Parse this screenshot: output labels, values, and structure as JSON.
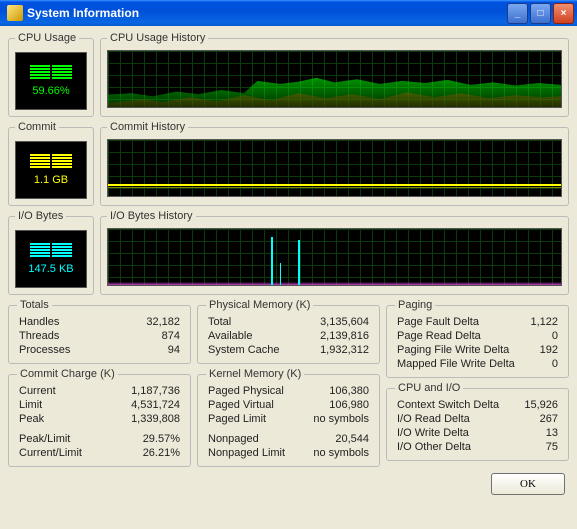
{
  "window": {
    "title": "System Information"
  },
  "gauges": {
    "cpu": {
      "legend": "CPU Usage",
      "value": "59.66%",
      "history_legend": "CPU Usage History"
    },
    "commit": {
      "legend": "Commit",
      "value": "1.1 GB",
      "history_legend": "Commit History"
    },
    "io": {
      "legend": "I/O Bytes",
      "value": "147.5  KB",
      "history_legend": "I/O Bytes History"
    }
  },
  "totals": {
    "legend": "Totals",
    "handles_k": "Handles",
    "handles_v": "32,182",
    "threads_k": "Threads",
    "threads_v": "874",
    "processes_k": "Processes",
    "processes_v": "94"
  },
  "commit_charge": {
    "legend": "Commit Charge (K)",
    "current_k": "Current",
    "current_v": "1,187,736",
    "limit_k": "Limit",
    "limit_v": "4,531,724",
    "peak_k": "Peak",
    "peak_v": "1,339,808",
    "peak_limit_k": "Peak/Limit",
    "peak_limit_v": "29.57%",
    "current_limit_k": "Current/Limit",
    "current_limit_v": "26.21%"
  },
  "physical": {
    "legend": "Physical Memory (K)",
    "total_k": "Total",
    "total_v": "3,135,604",
    "avail_k": "Available",
    "avail_v": "2,139,816",
    "cache_k": "System Cache",
    "cache_v": "1,932,312"
  },
  "kernel": {
    "legend": "Kernel Memory (K)",
    "pp_k": "Paged Physical",
    "pp_v": "106,380",
    "pv_k": "Paged Virtual",
    "pv_v": "106,980",
    "pl_k": "Paged Limit",
    "pl_v": "no symbols",
    "np_k": "Nonpaged",
    "np_v": "20,544",
    "npl_k": "Nonpaged Limit",
    "npl_v": "no symbols"
  },
  "paging": {
    "legend": "Paging",
    "pf_k": "Page Fault Delta",
    "pf_v": "1,122",
    "pr_k": "Page Read Delta",
    "pr_v": "0",
    "pfw_k": "Paging File Write Delta",
    "pfw_v": "192",
    "mfw_k": "Mapped File Write Delta",
    "mfw_v": "0"
  },
  "cpuio": {
    "legend": "CPU and I/O",
    "cs_k": "Context Switch Delta",
    "cs_v": "15,926",
    "ir_k": "I/O Read Delta",
    "ir_v": "267",
    "iw_k": "I/O Write Delta",
    "iw_v": "13",
    "io_k": "I/O Other Delta",
    "io_v": "75"
  },
  "buttons": {
    "ok": "OK"
  }
}
